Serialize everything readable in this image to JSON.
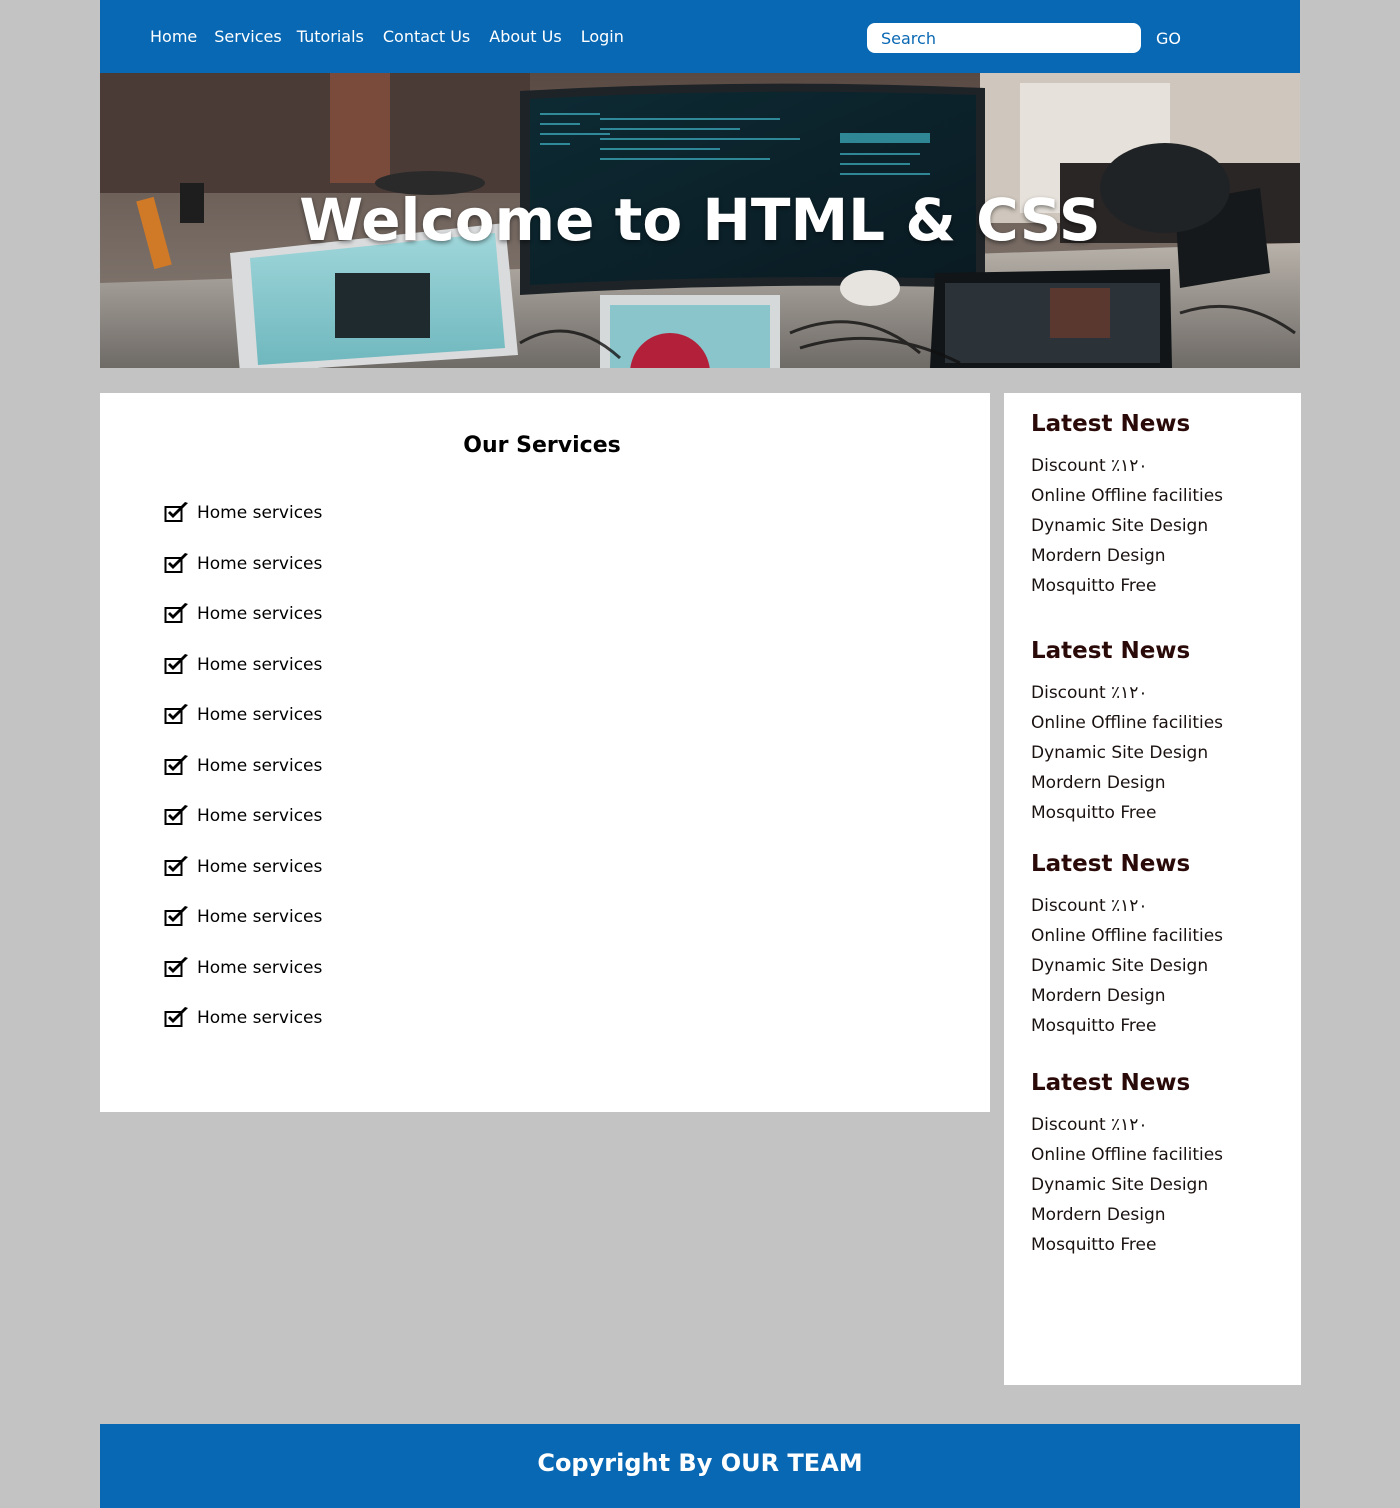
{
  "header": {
    "nav": [
      "Home",
      "Services",
      "Tutorials",
      "Contact Us",
      "About Us",
      "Login"
    ],
    "search_placeholder": "Search",
    "go_label": "GO"
  },
  "hero": {
    "title": "Welcome to HTML & CSS"
  },
  "services": {
    "title": "Our Services",
    "items": [
      "Home services",
      "Home services",
      "Home services",
      "Home services",
      "Home services",
      "Home services",
      "Home services",
      "Home services",
      "Home services",
      "Home services",
      "Home services"
    ]
  },
  "sidebar": {
    "blocks": [
      {
        "title": "Latest News",
        "items": [
          "Discount ٪١٢٠",
          "Online Offline facilities",
          "Dynamic Site Design",
          "Mordern Design",
          "Mosquitto Free"
        ]
      },
      {
        "title": "Latest News",
        "items": [
          "Discount ٪١٢٠",
          "Online Offline facilities",
          "Dynamic Site Design",
          "Mordern Design",
          "Mosquitto Free"
        ]
      },
      {
        "title": "Latest News",
        "items": [
          "Discount ٪١٢٠",
          "Online Offline facilities",
          "Dynamic Site Design",
          "Mordern Design",
          "Mosquitto Free"
        ]
      },
      {
        "title": "Latest News",
        "items": [
          "Discount ٪١٢٠",
          "Online Offline facilities",
          "Dynamic Site Design",
          "Mordern Design",
          "Mosquitto Free"
        ]
      }
    ]
  },
  "footer": {
    "text": "Copyright By OUR TEAM"
  },
  "colors": {
    "brand_blue": "#0968b3",
    "page_background": "#c3c3c3",
    "panel_background": "#ffffff",
    "news_title": "#2a0a08"
  },
  "icons": {
    "service_bullet": "checkbox-checked-icon"
  }
}
